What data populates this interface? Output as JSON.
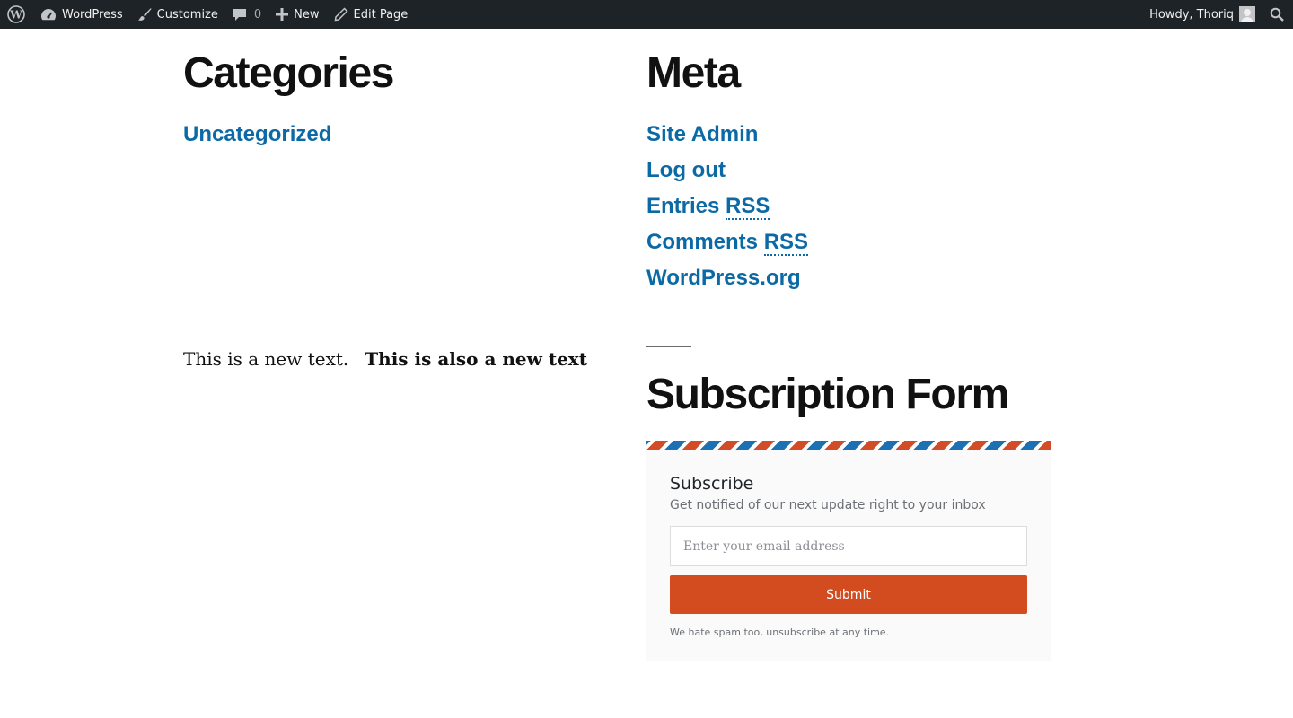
{
  "adminbar": {
    "wp_icon": "wordpress-logo-icon",
    "site_name": "WordPress",
    "customize": "Customize",
    "comments_count": "0",
    "new_label": "New",
    "edit_page": "Edit Page",
    "howdy": "Howdy, Thoriq"
  },
  "categories": {
    "title": "Categories",
    "items": [
      "Uncategorized"
    ]
  },
  "meta": {
    "title": "Meta",
    "site_admin": "Site Admin",
    "log_out": "Log out",
    "entries": "Entries",
    "comments": "Comments",
    "rss": "RSS",
    "wordpress_org": "WordPress.org"
  },
  "texts": {
    "plain": "This is a new text.",
    "bold": "This is also a new text"
  },
  "subscription": {
    "title": "Subscription Form",
    "heading": "Subscribe",
    "description": "Get notified of our next update right to your inbox",
    "email_placeholder": "Enter your email address",
    "submit": "Submit",
    "note": "We hate spam too, unsubscribe at any time.",
    "accent_colors": [
      "#d24c27",
      "#1d71b2"
    ]
  }
}
